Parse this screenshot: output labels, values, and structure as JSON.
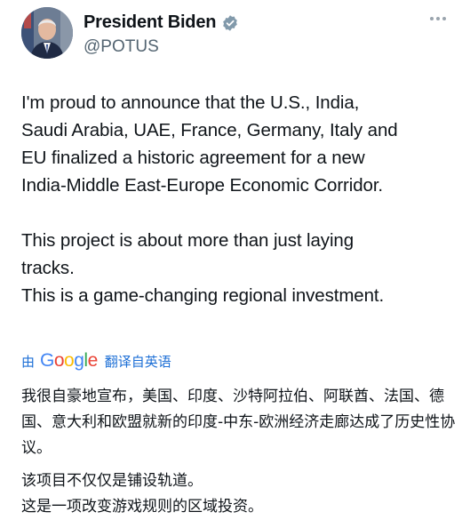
{
  "author": {
    "name": "President Biden",
    "handle": "@POTUS"
  },
  "tweet": {
    "paragraphs": [
      "I'm proud to announce that the U.S., India,\nSaudi Arabia, UAE, France, Germany, Italy and\nEU finalized a historic agreement for a new\nIndia-Middle East-Europe Economic Corridor.",
      "This project is about more than just laying\ntracks.\nThis is a game-changing regional investment."
    ]
  },
  "translate": {
    "by": "由",
    "google": [
      "G",
      "o",
      "o",
      "g",
      "l",
      "e"
    ],
    "label": "翻译自英语"
  },
  "translation": {
    "paragraphs": [
      "我很自豪地宣布，美国、印度、沙特阿拉伯、阿联酋、法国、德国、意大利和欧盟就新的印度-中东-欧洲经济走廊达成了历史性协议。",
      "该项目不仅仅是铺设轨道。\n这是一项改变游戏规则的区域投资。"
    ]
  },
  "colors": {
    "link": "#1d6fd6",
    "handle": "#536471",
    "verified": "#829aab"
  },
  "icons": [
    "verified-badge-icon",
    "more-options-icon"
  ]
}
